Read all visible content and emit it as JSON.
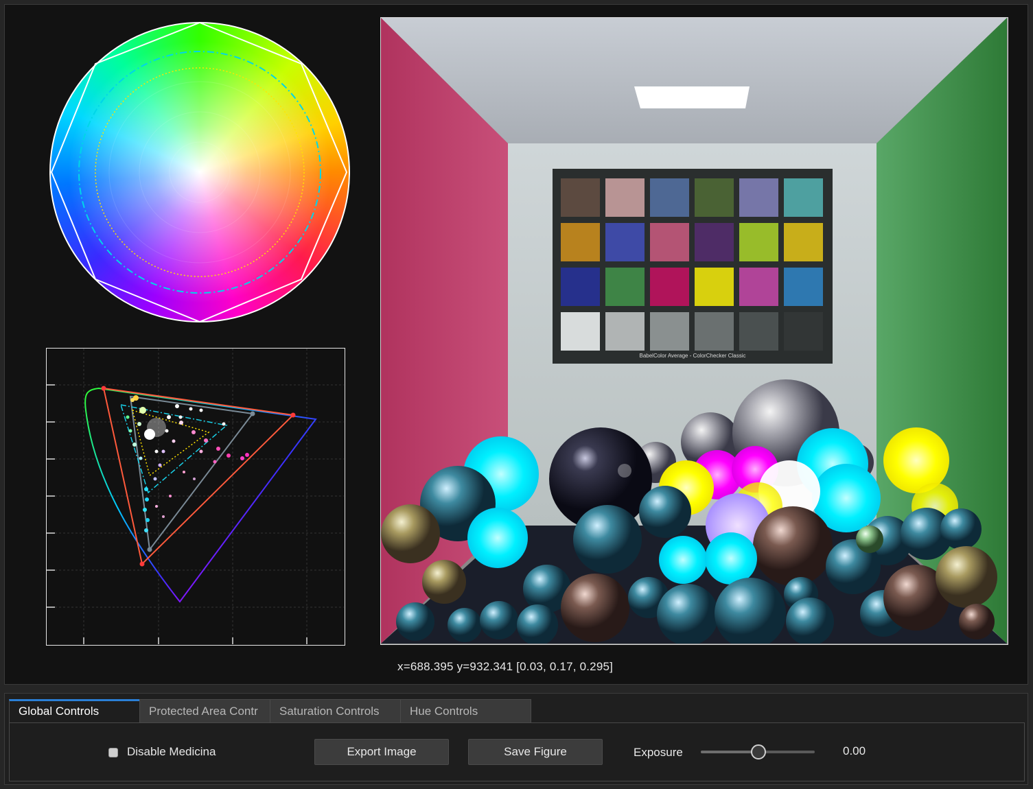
{
  "readout": {
    "text": "x=688.395 y=932.341 [0.03, 0.17, 0.295]"
  },
  "tabs": [
    {
      "label": "Global Controls",
      "active": true
    },
    {
      "label": "Protected Area Contr",
      "active": false
    },
    {
      "label": "Saturation Controls",
      "active": false
    },
    {
      "label": "Hue Controls",
      "active": false
    }
  ],
  "global_controls": {
    "disable_checkbox_label": "Disable Medicina",
    "disable_checked": false,
    "export_button": "Export Image",
    "save_button": "Save Figure",
    "exposure_label": "Exposure",
    "exposure_value": "0.00",
    "exposure_slider_fraction": 0.5
  },
  "chart_board": {
    "caption": "BabelColor Average - ColorChecker Classic",
    "patches": [
      "#5c4a40",
      "#b89494",
      "#4e6894",
      "#4a6234",
      "#7676a8",
      "#4ea0a0",
      "#b8821e",
      "#3e4aa6",
      "#b45474",
      "#4e2c66",
      "#98bc2a",
      "#c8ae1a",
      "#26308c",
      "#3e8446",
      "#b0145a",
      "#d8d00e",
      "#b04498",
      "#2e78b0",
      "#d8dcdc",
      "#b0b4b4",
      "#8a9090",
      "#6a7070",
      "#4a5050",
      "#323636"
    ]
  },
  "colors": {
    "panel_bg": "#121212",
    "accent": "#2a7fd6"
  }
}
